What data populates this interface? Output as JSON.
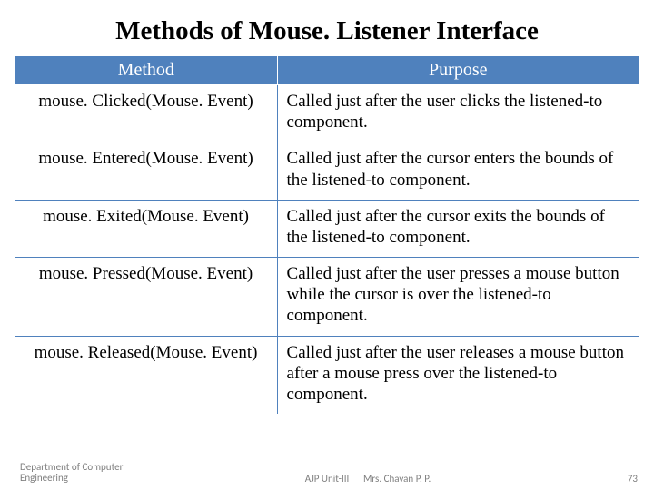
{
  "title": "Methods of Mouse. Listener Interface",
  "headers": {
    "method": "Method",
    "purpose": "Purpose"
  },
  "rows": [
    {
      "method": "mouse. Clicked(Mouse. Event)",
      "purpose": "Called just after the user clicks the listened-to component."
    },
    {
      "method": "mouse. Entered(Mouse. Event)",
      "purpose": "Called just after the cursor enters the bounds of the listened-to component."
    },
    {
      "method": "mouse. Exited(Mouse. Event)",
      "purpose": "Called just after the cursor exits the bounds of the listened-to component."
    },
    {
      "method": "mouse. Pressed(Mouse. Event)",
      "purpose": "Called just after the user presses a mouse button while the cursor is over the listened-to component."
    },
    {
      "method": "mouse. Released(Mouse. Event)",
      "purpose": "Called just after the user releases a mouse button after a mouse press over the listened-to component."
    }
  ],
  "footer": {
    "dept": "Department of Computer Engineering",
    "unit": "AJP Unit-III",
    "author": "Mrs. Chavan P. P.",
    "page": "73"
  }
}
